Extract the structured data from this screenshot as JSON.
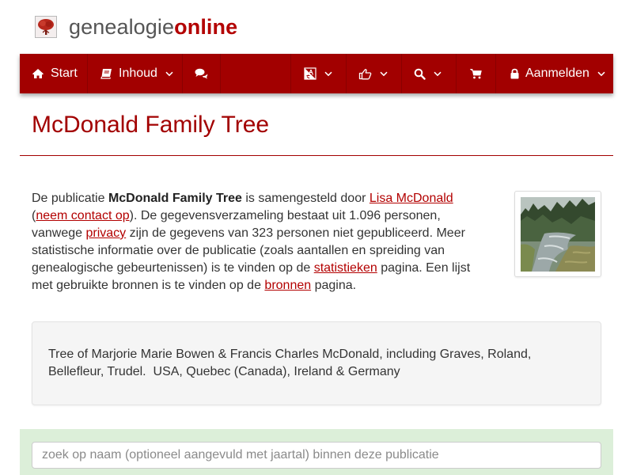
{
  "brand": {
    "name_part1": "genealogie",
    "name_part2": "online"
  },
  "nav": {
    "start_label": "Start",
    "content_label": "Inhoud",
    "login_label": "Aanmelden"
  },
  "page": {
    "title": "McDonald Family Tree"
  },
  "intro": {
    "t1": "De publicatie ",
    "pub_name": "McDonald Family Tree",
    "t2": " is samengesteld door ",
    "author_link": "Lisa McDonald",
    "t3": " (",
    "contact_link": "neem contact op",
    "t4": "). De gegevensverzameling bestaat uit 1.096 personen, vanwege ",
    "privacy_link": "privacy",
    "t5": " zijn de gegevens van 323 personen niet gepubliceerd. Meer statistische informatie over de publicatie (zoals aantallen en spreiding van genealogische gebeurtenissen) is te vinden op de ",
    "stats_link": "statistieken",
    "t6": " pagina. Een lijst met gebruikte bronnen is te vinden op de ",
    "sources_link": "bronnen",
    "t7": " pagina."
  },
  "description": "Tree of Marjorie Marie Bowen & Francis Charles McDonald, including Graves, Roland, Bellefleur, Trudel.  USA, Quebec (Canada), Ireland & Germany",
  "search": {
    "placeholder": "zoek op naam (optioneel aangevuld met jaartal) binnen deze publicatie"
  },
  "colors": {
    "brand_red": "#a20000",
    "link_red": "#b30000",
    "search_band": "#dcefd9",
    "well_bg": "#f5f5f5"
  },
  "icons": [
    "tree-logo-icon",
    "home-icon",
    "book-icon",
    "comments-icon",
    "language-icon",
    "thumbs-up-icon",
    "search-icon",
    "shopping-cart-icon",
    "lock-icon",
    "chevron-down-icon"
  ]
}
